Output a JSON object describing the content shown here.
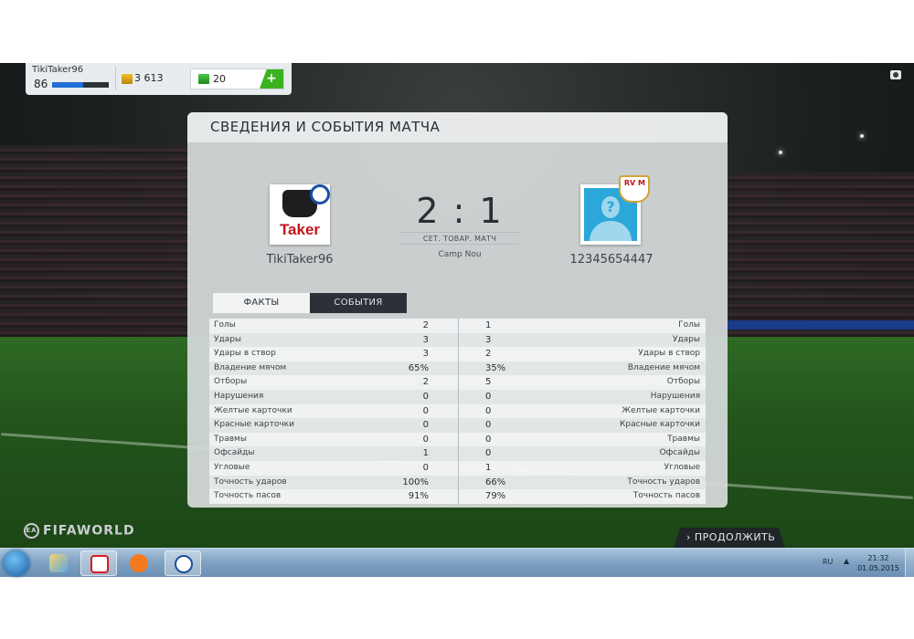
{
  "account": {
    "username": "TikiTaker96",
    "level": "86",
    "xp_progress_pct": 55,
    "coins": "3 613",
    "fifa_points": "20",
    "add_label": "+"
  },
  "panel": {
    "title": "СВЕДЕНИЯ И СОБЫТИЯ МАТЧА",
    "home_team": "TikiTaker96",
    "away_team": "12345654447",
    "home_badge_text": "Taker",
    "away_badge_mark": "?",
    "away_crest_text": "RV M",
    "score": "2 : 1",
    "match_type": "СЕТ. ТОВАР. МАТЧ",
    "stadium": "Camp Nou",
    "tabs": [
      "ФАКТЫ",
      "СОБЫТИЯ"
    ],
    "stats": [
      {
        "name": "Голы",
        "home": "2",
        "away": "1"
      },
      {
        "name": "Удары",
        "home": "3",
        "away": "3"
      },
      {
        "name": "Удары в створ",
        "home": "3",
        "away": "2"
      },
      {
        "name": "Владение мячом",
        "home": "65%",
        "away": "35%"
      },
      {
        "name": "Отборы",
        "home": "2",
        "away": "5"
      },
      {
        "name": "Нарушения",
        "home": "0",
        "away": "0"
      },
      {
        "name": "Желтые карточки",
        "home": "0",
        "away": "0"
      },
      {
        "name": "Красные карточки",
        "home": "0",
        "away": "0"
      },
      {
        "name": "Травмы",
        "home": "0",
        "away": "0"
      },
      {
        "name": "Офсайды",
        "home": "1",
        "away": "0"
      },
      {
        "name": "Угловые",
        "home": "0",
        "away": "1"
      },
      {
        "name": "Точность ударов",
        "home": "100%",
        "away": "66%"
      },
      {
        "name": "Точность пасов",
        "home": "91%",
        "away": "79%"
      }
    ]
  },
  "footer": {
    "logo": "FIFAWORLD",
    "ea_mark": "EA",
    "continue_label": "› ПРОДОЛЖИТЬ"
  },
  "taskbar": {
    "lang": "RU",
    "time": "21:32",
    "date": "01.05.2015"
  },
  "colors": {
    "accent_green": "#3ab21e",
    "xp_blue": "#1f6fd6",
    "tab_dark": "#2b3137"
  }
}
